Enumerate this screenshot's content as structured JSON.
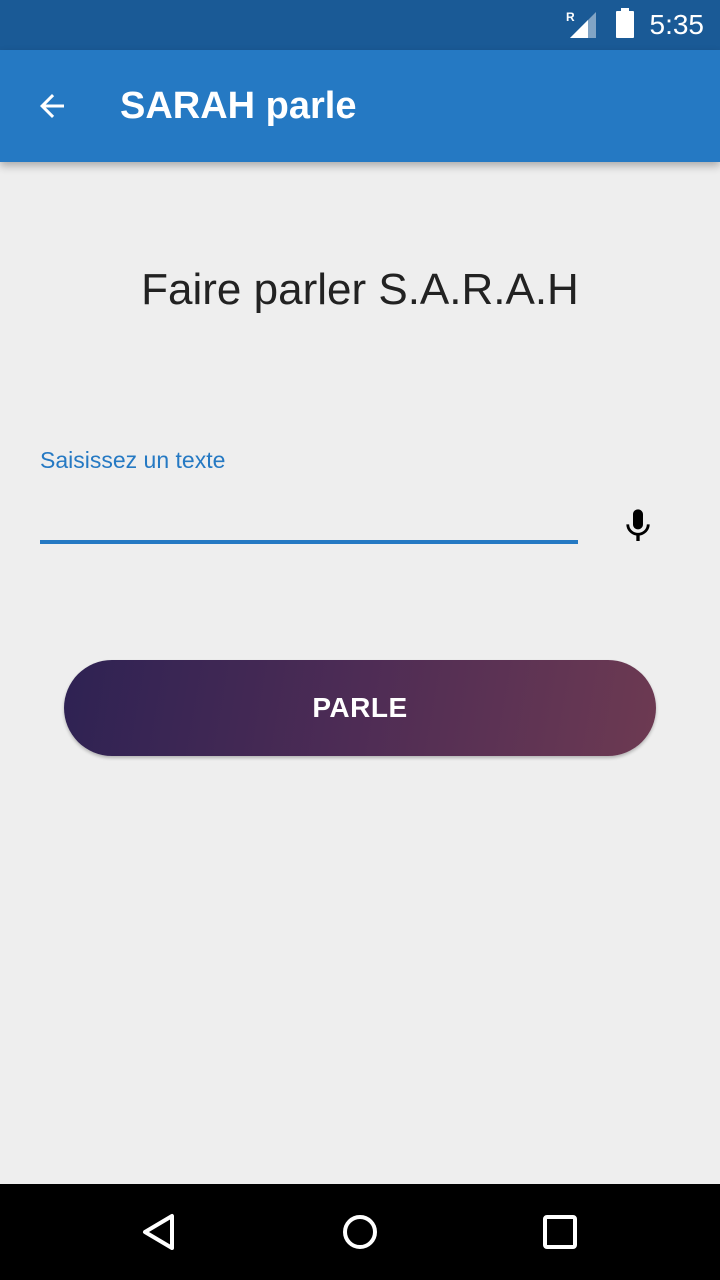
{
  "status_bar": {
    "time": "5:35",
    "network_label": "R",
    "icons": [
      "signal-roaming-icon",
      "battery-icon"
    ]
  },
  "app_bar": {
    "title": "SARAH parle",
    "back_icon": "arrow-back-icon",
    "color": "#2579c3"
  },
  "main": {
    "heading": "Faire parler S.A.R.A.H",
    "input": {
      "label": "Saisissez un texte",
      "value": "",
      "placeholder": ""
    },
    "mic_icon": "microphone-icon",
    "speak_button": {
      "label": "PARLE",
      "gradient": [
        "#2e2253",
        "#6d3a52"
      ]
    }
  },
  "nav_bar": {
    "icons": [
      "nav-back-icon",
      "nav-home-icon",
      "nav-recents-icon"
    ]
  },
  "colors": {
    "accent": "#2579c3",
    "status_bar": "#1a5a96",
    "background": "#eeeeee"
  }
}
